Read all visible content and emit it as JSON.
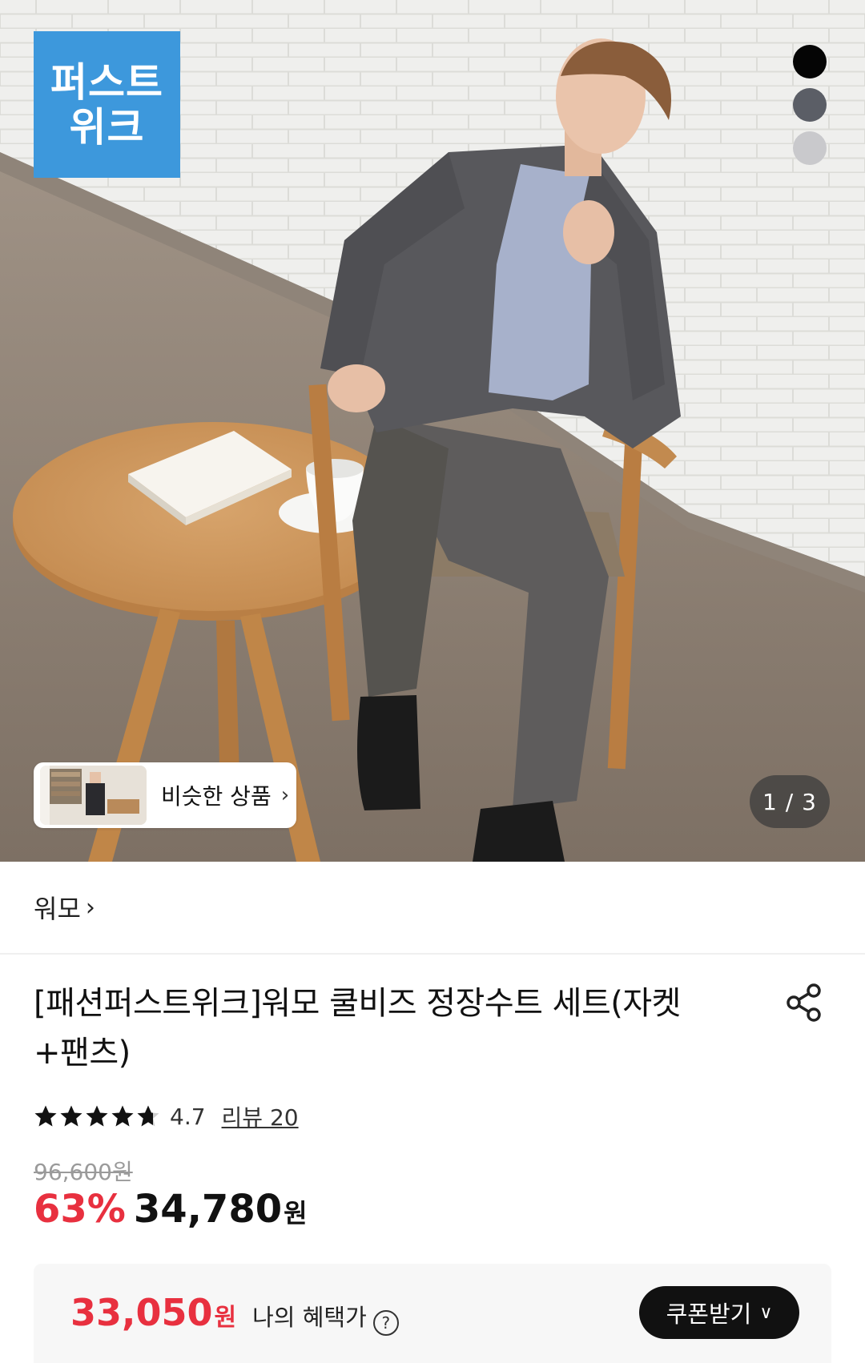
{
  "hero": {
    "badge_line1": "퍼스트",
    "badge_line2": "위크",
    "color_options": [
      "#050505",
      "#5b5e66",
      "#c9c9cc"
    ],
    "similar_label": "비슷한 상품",
    "page_current": "1",
    "page_total": "3"
  },
  "brand": {
    "name": "워모"
  },
  "product": {
    "title": "[패션퍼스트위크]워모 쿨비즈 정장수트 세트(자켓+팬츠)",
    "rating": "4.7",
    "rating_value": 4.7,
    "rating_max": 5,
    "review_label": "리뷰 20",
    "original_price": "96,600원",
    "discount_rate": "63%",
    "sale_price": "34,780",
    "currency": "원"
  },
  "benefit": {
    "amount": "33,050",
    "currency": "원",
    "label": "나의 혜택가",
    "help_symbol": "?",
    "coupon_label": "쿠폰받기"
  },
  "colors": {
    "accent_red": "#e8303f",
    "badge_blue": "#3d98dc",
    "dark": "#111111"
  }
}
